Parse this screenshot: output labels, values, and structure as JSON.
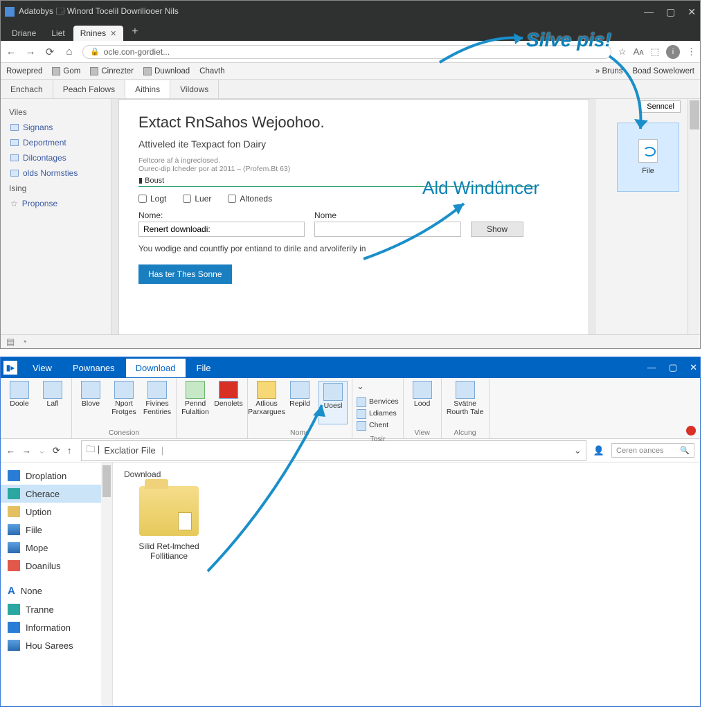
{
  "browser": {
    "titlebar": {
      "text": "Adatobys   🗔  Winord Tocelil Dowriliooer Nils",
      "buttons": {
        "min": "—",
        "max": "▢",
        "close": "✕"
      }
    },
    "chrome_menus": [
      "Driane",
      "Liet"
    ],
    "tab": {
      "label": "Rnines",
      "close": "✕"
    },
    "new_tab": "+",
    "nav": {
      "back": "←",
      "fwd": "→",
      "reload": "⟳",
      "home": "⌂",
      "lock": "🔒"
    },
    "url": "ocle.con-gordiet...",
    "url_right": {
      "star": "☆",
      "a1": "Aᴀ",
      "a2": "⬚",
      "avatar": "i",
      "menu": "⋮"
    },
    "bookmarks": [
      {
        "label": "Rowepred"
      },
      {
        "label": "Gom",
        "icon": true
      },
      {
        "label": "Cinrezter",
        "icon": true
      },
      {
        "label": "Duwnload",
        "icon": true
      },
      {
        "label": "Chavth"
      }
    ],
    "bm_right": [
      {
        "label": "»  Bruns",
        "icon": true
      },
      {
        "label": "Boad Sowelowert"
      }
    ],
    "page_tabs": [
      {
        "label": "Enchach"
      },
      {
        "label": "Peach Falows"
      },
      {
        "label": "Aithins",
        "active": true
      },
      {
        "label": "Vildows"
      }
    ],
    "sidebar": {
      "head": "Viles",
      "items": [
        {
          "label": "Signans"
        },
        {
          "label": "Deportment"
        },
        {
          "label": "Dilcontages"
        },
        {
          "label": "olds Normsties"
        }
      ],
      "extra": "Ising",
      "fav": "Proponse"
    },
    "panel": {
      "title": "Extact RnSahos Wejoohoo.",
      "subtitle": "Attiveled ite Texpact fon Dairy",
      "meta1": "Feltcore af à ingreclosed.",
      "meta2": "Ourec-dip Icheder por at 2011 – (Profem.Bt 63)",
      "bolist": "▮  Boust",
      "checks": [
        {
          "label": "Logt"
        },
        {
          "label": "Luer"
        },
        {
          "label": "Altoneds"
        }
      ],
      "name1_label": "Nome:",
      "name1_value": "Renert downloadi:",
      "name2_label": "Nome",
      "name2_value": "",
      "btn_show": "Show",
      "info": "You wodige and countfiy por entiand to dirile and arvoliferily in",
      "btn_primary": "Has ter Thes Sonne"
    },
    "right_panel": {
      "btn": "Senncel",
      "gear": "⚙",
      "file_label": "File"
    },
    "status": {
      "a": "▤",
      "b": "◔"
    }
  },
  "explorer": {
    "title_icon": "▮▸",
    "tabs": [
      {
        "label": "View"
      },
      {
        "label": "Pownanes"
      },
      {
        "label": "Download",
        "active": true
      },
      {
        "label": "File"
      }
    ],
    "win_btns": {
      "min": "—",
      "max": "▢",
      "close": "✕"
    },
    "ribbon": {
      "g1": [
        {
          "label": "Doole"
        },
        {
          "label": "Lafl"
        }
      ],
      "g2": [
        {
          "label": "Blove"
        },
        {
          "label": "Nport Frotges"
        },
        {
          "label": "Fivines Fentiries"
        }
      ],
      "g2_label": "Conesion",
      "g3": [
        {
          "label": "Pennd Fulaltion"
        },
        {
          "label": "Denolets"
        }
      ],
      "g4": [
        {
          "label": "Atlious Parxargues"
        },
        {
          "label": "Repild"
        },
        {
          "label": "Uoesl"
        }
      ],
      "g4_label": "Nome",
      "g5_small": [
        {
          "label": "Benvices"
        },
        {
          "label": "Ldiames"
        },
        {
          "label": "Chent"
        }
      ],
      "g5_label": "Tosir",
      "g6": [
        {
          "label": "Lood"
        }
      ],
      "g6_label": "View",
      "g7": [
        {
          "label": "Svätne Rourth Tale"
        }
      ],
      "g7_label": "Alcung"
    },
    "addr": {
      "back": "←",
      "fwd": "→",
      "reload": "⟳",
      "up": "↑",
      "path": "Exclatior File",
      "caret": "⌄",
      "user": "👤"
    },
    "search_placeholder": "Ceren oances",
    "sidebar": [
      {
        "label": "Droplation",
        "icon": "ic-blue"
      },
      {
        "label": "Cherace",
        "icon": "ic-teal",
        "sel": true
      },
      {
        "label": "Uption",
        "icon": "ic-gold",
        "chev": true
      },
      {
        "label": "Fiile",
        "icon": "ic-nav"
      },
      {
        "label": "Mope",
        "icon": "ic-nav"
      },
      {
        "label": "Doanilus",
        "icon": "ic-red",
        "chev": true
      },
      {
        "label": "None",
        "icon": "ic-az"
      },
      {
        "label": "Tranne",
        "icon": "ic-teal"
      },
      {
        "label": "Information",
        "icon": "ic-blue",
        "chev": true
      },
      {
        "label": "Hou Sarees",
        "icon": "ic-nav",
        "chev": true
      }
    ],
    "crumb": "Download",
    "folder": "Silid Ret-lmched Follitiance"
  },
  "annotations": {
    "a1": "Silve pis!",
    "a2": "Ald Windûncer"
  }
}
